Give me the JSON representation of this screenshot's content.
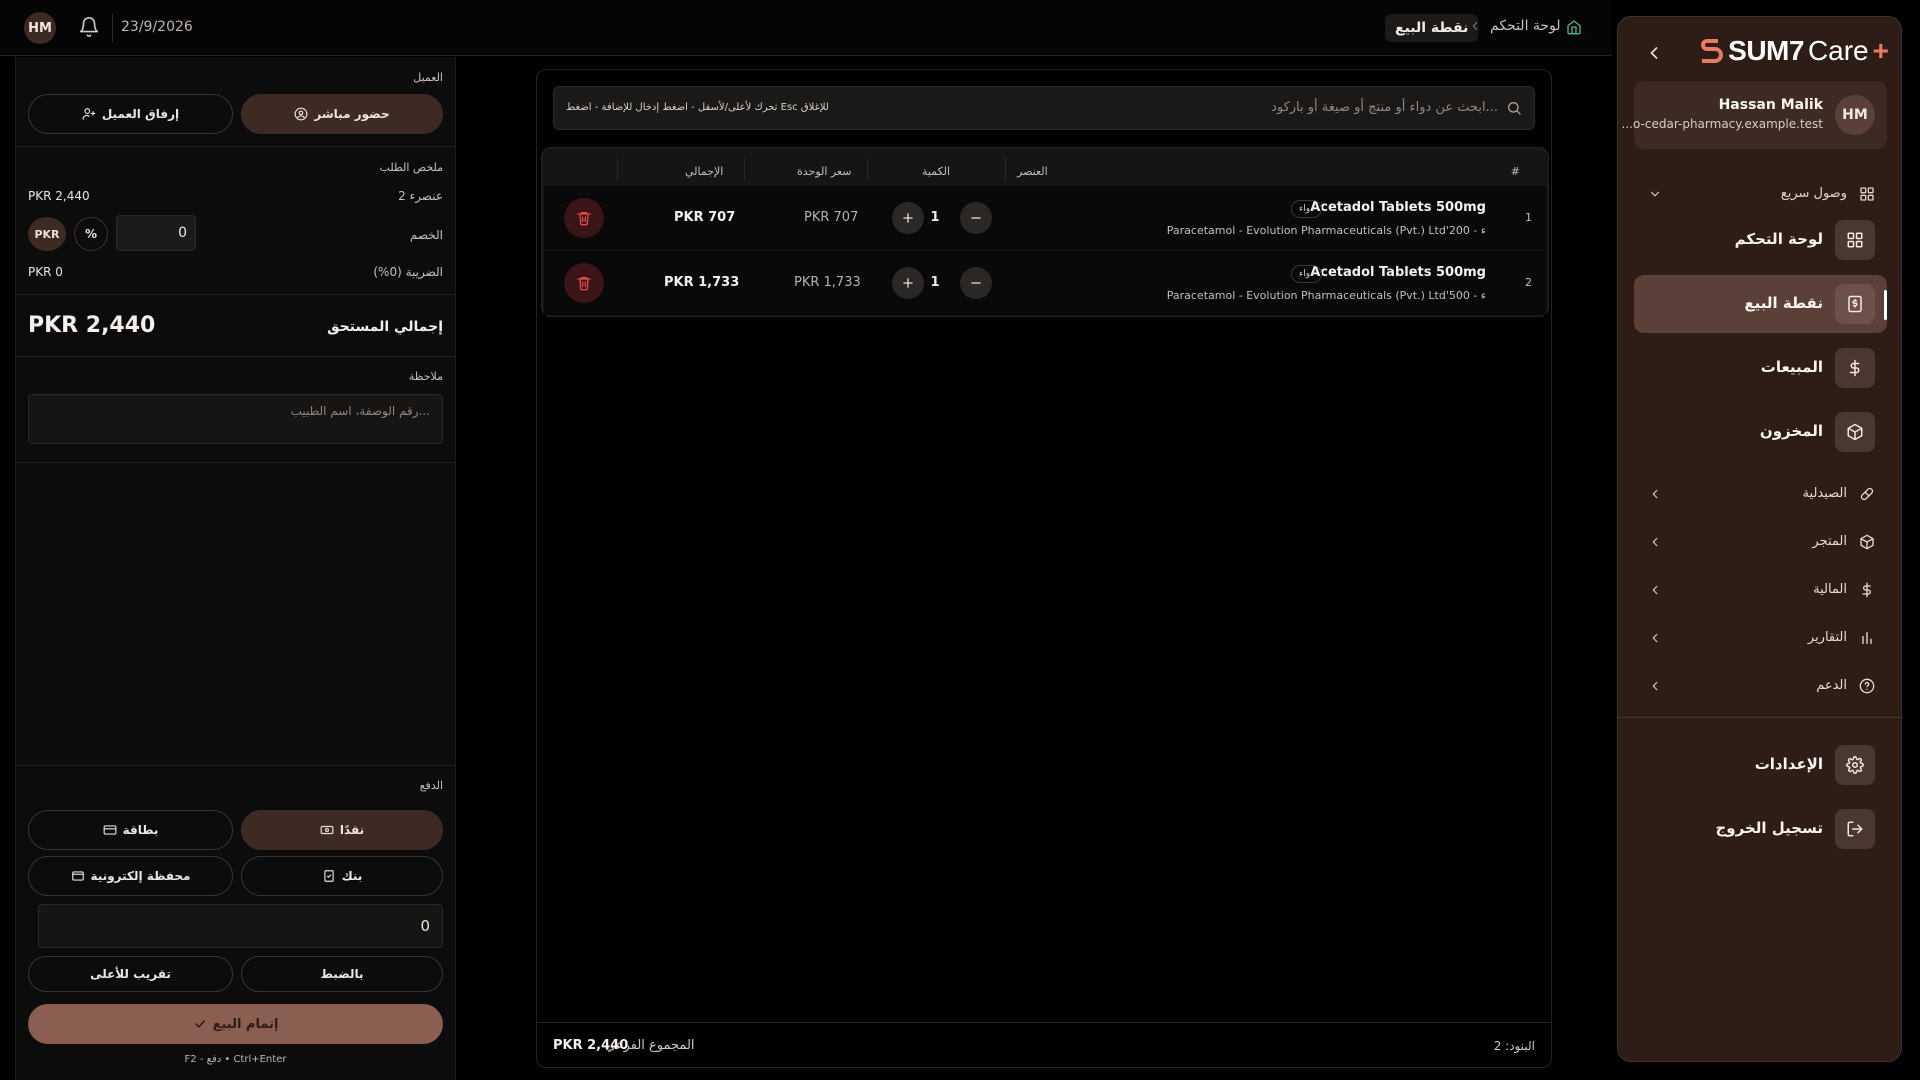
{
  "topbar": {
    "avatar": "HM",
    "date": "23/9/2026",
    "breadcrumb_home": "لوحة التحكم",
    "breadcrumb_current": "نقطة البيع"
  },
  "sidebar": {
    "brand": "SUM7",
    "product": "Care",
    "plus": "+",
    "user": {
      "initials": "HM",
      "name": "Hassan Malik",
      "email": "...o-cedar-pharmacy.example.test"
    },
    "quick_access": "وصول سريع",
    "nav": [
      {
        "label": "لوحة التحكم",
        "icon": "grid-icon"
      },
      {
        "label": "نقطة البيع",
        "icon": "pos-icon",
        "active": true
      },
      {
        "label": "المبيعات",
        "icon": "dollar-icon"
      },
      {
        "label": "المخزون",
        "icon": "box-icon"
      }
    ],
    "groups": [
      {
        "label": "الصيدلية",
        "icon": "pill-icon"
      },
      {
        "label": "المتجر",
        "icon": "package-icon"
      },
      {
        "label": "المالية",
        "icon": "dollar-icon"
      },
      {
        "label": "التقارير",
        "icon": "bar-chart-icon"
      },
      {
        "label": "الدعم",
        "icon": "help-icon"
      }
    ],
    "settings": "الإعدادات",
    "logout": "تسجيل الخروج"
  },
  "order": {
    "customer_title": "العميل",
    "walk_in": "حضور مباشر",
    "attach_customer": "إرفاق العميل",
    "summary_title": "ملخص الطلب",
    "items_count_label": "2 عنصرء",
    "items_total": "PKR 2,440",
    "discount_label": "الخصم",
    "discount_value": "0",
    "discount_pct": "%",
    "discount_currency": "PKR",
    "tax_label": "الضريبة (0%)",
    "tax_value": "PKR 0",
    "total_label": "إجمالي المستحق",
    "total_value": "PKR 2,440",
    "note_title": "ملاحظة",
    "note_placeholder": "رقم الوصفة، اسم الطبيب...",
    "payment_title": "الدفع",
    "pay_cash": "نقدًا",
    "pay_card": "بطاقة",
    "pay_bank": "بنك",
    "pay_wallet": "محفظة إلكترونية",
    "amount": "0",
    "exact": "بالضبط",
    "round_up": "تقريب للأعلى",
    "complete": "إتمام البيع",
    "shortcut": "F2 - دفع • Ctrl+Enter"
  },
  "cart": {
    "search_placeholder": "ابحث عن دواء أو منتج أو صيغة أو باركود...",
    "search_hint": "تحرك لأعلى/لأسفل - اضغط إدخال للإضافة - اضغط Esc للإغلاق",
    "headers": {
      "index": "#",
      "item": "العنصر",
      "qty": "الكمية",
      "unit_price": "سعر الوحدة",
      "total": "الإجمالي"
    },
    "rows": [
      {
        "index": "1",
        "name": "Acetadol Tablets 500mg",
        "tag": "دواء",
        "sub": "Paracetamol - Evolution Pharmaceuticals (Pvt.) Ltd'200 - ء",
        "qty": "1",
        "unit_price": "PKR 707",
        "total": "PKR 707"
      },
      {
        "index": "2",
        "name": "Acetadol Tablets 500mg",
        "tag": "دواء",
        "sub": "Paracetamol - Evolution Pharmaceuticals (Pvt.) Ltd'500 - ء",
        "qty": "1",
        "unit_price": "PKR 1,733",
        "total": "PKR 1,733"
      }
    ],
    "items_footer": "البنود: 2",
    "subtotal_label": "المجموع الفرعي",
    "subtotal_value": "PKR 2,440"
  }
}
